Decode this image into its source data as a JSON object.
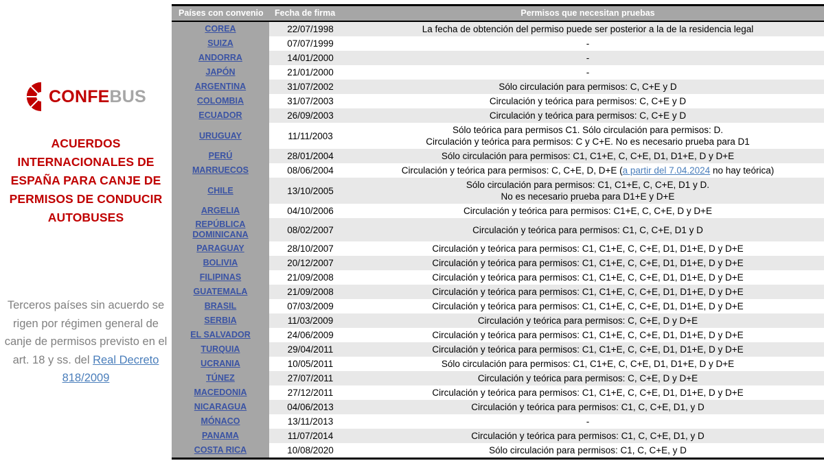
{
  "sidebar": {
    "logo": {
      "part1": "CONFE",
      "part2": "BUS",
      "mark": "bus-wheel-logo-icon"
    },
    "title": "ACUERDOS INTERNACIONALES DE ESPAÑA PARA CANJE DE PERMISOS DE CONDUCIR AUTOBUSES",
    "note_text": "Terceros países sin acuerdo se rigen por régimen general de canje de permisos previsto en el art. 18 y ss. del",
    "note_link": "Real Decreto 818/2009"
  },
  "table": {
    "headers": {
      "country": "Países con convenio",
      "date": "Fecha de firma",
      "permits": "Permisos que necesitan pruebas"
    },
    "rows": [
      {
        "country": "COREA",
        "date": "22/07/1998",
        "permits": [
          "La fecha de obtención del permiso puede ser posterior a la de la residencia legal"
        ]
      },
      {
        "country": "SUIZA",
        "date": "07/07/1999",
        "permits": [
          "-"
        ]
      },
      {
        "country": "ANDORRA",
        "date": "14/01/2000",
        "permits": [
          "-"
        ]
      },
      {
        "country": "JAPÓN",
        "date": "21/01/2000",
        "permits": [
          "-"
        ]
      },
      {
        "country": "ARGENTINA",
        "date": "31/07/2002",
        "permits": [
          "Sólo circulación para permisos: C, C+E y D"
        ]
      },
      {
        "country": "COLOMBIA",
        "date": "31/07/2003",
        "permits": [
          "Circulación y teórica para permisos: C, C+E y D"
        ]
      },
      {
        "country": "ECUADOR",
        "date": "26/09/2003",
        "permits": [
          "Circulación y teórica para permisos: C, C+E y D"
        ]
      },
      {
        "country": "URUGUAY",
        "date": "11/11/2003",
        "permits": [
          "Sólo teórica para permisos C1. Sólo circulación para permisos: D.",
          "Circulación y teórica para permisos: C y C+E. No es necesario prueba para D1"
        ]
      },
      {
        "country": "PERÚ",
        "date": "28/01/2004",
        "permits": [
          "Sólo circulación para permisos: C1, C1+E, C, C+E, D1, D1+E, D y D+E"
        ]
      },
      {
        "country": "MARRUECOS",
        "date": "08/06/2004",
        "permits_rich": {
          "before": "Circulación y teórica para permisos: C, C+E, D, D+E (",
          "link": "a partir del 7.04.2024",
          "after": " no hay teórica)"
        }
      },
      {
        "country": "CHILE",
        "date": "13/10/2005",
        "permits": [
          "Sólo circulación para permisos: C1, C1+E, C, C+E, D1 y D.",
          "No es necesario prueba para D1+E y D+E"
        ]
      },
      {
        "country": "ARGELIA",
        "date": "04/10/2006",
        "permits": [
          "Circulación y teórica para permisos: C1+E, C, C+E, D y D+E"
        ]
      },
      {
        "country": "REPÚBLICA DOMINICANA",
        "date": "08/02/2007",
        "permits": [
          "Circulación y teórica para permisos: C1, C, C+E, D1 y D"
        ]
      },
      {
        "country": "PARAGUAY",
        "date": "28/10/2007",
        "permits": [
          "Circulación y teórica para permisos: C1, C1+E, C, C+E, D1, D1+E, D y D+E"
        ]
      },
      {
        "country": "BOLIVIA",
        "date": "20/12/2007",
        "permits": [
          "Circulación y teórica para permisos: C1, C1+E, C, C+E, D1, D1+E, D y D+E"
        ]
      },
      {
        "country": "FILIPINAS",
        "date": "21/09/2008",
        "permits": [
          "Circulación y teórica para permisos: C1, C1+E, C, C+E, D1, D1+E, D y D+E"
        ]
      },
      {
        "country": "GUATEMALA",
        "date": "21/09/2008",
        "permits": [
          "Circulación y teórica para permisos: C1, C1+E, C, C+E, D1, D1+E, D y D+E"
        ]
      },
      {
        "country": "BRASIL",
        "date": "07/03/2009",
        "permits": [
          "Circulación y teórica para permisos: C1, C1+E, C, C+E, D1, D1+E, D y D+E"
        ]
      },
      {
        "country": "SERBIA",
        "date": "11/03/2009",
        "permits": [
          "Circulación y teórica para permisos: C, C+E, D y D+E"
        ]
      },
      {
        "country": "EL SALVADOR",
        "date": "24/06/2009",
        "permits": [
          "Circulación y teórica para permisos: C1, C1+E, C, C+E, D1, D1+E, D y D+E"
        ]
      },
      {
        "country": "TURQUIA",
        "date": "29/04/2011",
        "permits": [
          "Circulación y teórica para permisos: C1, C1+E, C, C+E, D1, D1+E, D y D+E"
        ]
      },
      {
        "country": "UCRANIA",
        "date": "10/05/2011",
        "permits": [
          "Sólo circulación para permisos: C1, C1+E, C, C+E, D1, D1+E, D y D+E"
        ]
      },
      {
        "country": "TÚNEZ",
        "date": "27/07/2011",
        "permits": [
          "Circulación y teórica para permisos: C, C+E, D y D+E"
        ]
      },
      {
        "country": "MACEDONIA",
        "date": "27/12/2011",
        "permits": [
          "Circulación y teórica para permisos: C1, C1+E, C, C+E, D1, D1+E, D y D+E"
        ]
      },
      {
        "country": "NICARAGUA",
        "date": "04/06/2013",
        "permits": [
          "Circulación y teórica para permisos: C1, C, C+E, D1, y D"
        ]
      },
      {
        "country": "MÓNACO",
        "date": "13/11/2013",
        "permits": [
          "-"
        ]
      },
      {
        "country": "PANAMA",
        "date": "11/07/2014",
        "permits": [
          "Circulación y teórica para permisos: C1, C, C+E, D1, y D"
        ]
      },
      {
        "country": "COSTA RICA",
        "date": "10/08/2020",
        "permits": [
          "Sólo circulación para permisos: C1, C, C+E, y D"
        ]
      }
    ]
  },
  "colors": {
    "brand_red": "#c00000",
    "logo_gray": "#a6a6a6",
    "link_blue": "#3a53a4",
    "note_gray": "#808080",
    "header_gray": "#a6a6a6",
    "stripe": "#e8e8e8"
  }
}
